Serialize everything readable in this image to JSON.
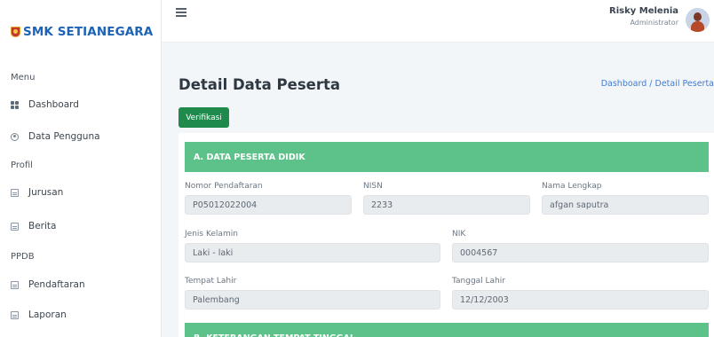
{
  "brand": {
    "name": "SMK SETIANEGARA"
  },
  "sidebar": {
    "menu_heading": "Menu",
    "profil_heading": "Profil",
    "ppdb_heading": "PPDB",
    "items": [
      {
        "label": "Dashboard",
        "icon": "dashboard-grid-icon"
      },
      {
        "label": "Data Pengguna",
        "icon": "user-circle-icon"
      },
      {
        "label": "Jurusan",
        "icon": "document-icon"
      },
      {
        "label": "Berita",
        "icon": "document-icon"
      },
      {
        "label": "Pendaftaran",
        "icon": "document-icon"
      },
      {
        "label": "Laporan",
        "icon": "document-icon"
      }
    ]
  },
  "topbar": {
    "user_name": "Risky Melenia",
    "user_role": "Administrator"
  },
  "page": {
    "title": "Detail Data Peserta",
    "breadcrumb": "Dashboard / Detail Peserta",
    "verify_label": "Verifikasi"
  },
  "section_a": {
    "title": "A. DATA PESERTA DIDIK",
    "fields": {
      "nomor_pendaftaran": {
        "label": "Nomor Pendaftaran",
        "value": "P05012022004"
      },
      "nisn": {
        "label": "NISN",
        "value": "2233"
      },
      "nama_lengkap": {
        "label": "Nama Lengkap",
        "value": "afgan saputra"
      },
      "jenis_kelamin": {
        "label": "Jenis Kelamin",
        "value": "Laki - laki"
      },
      "nik": {
        "label": "NIK",
        "value": "0004567"
      },
      "tempat_lahir": {
        "label": "Tempat Lahir",
        "value": "Palembang"
      },
      "tanggal_lahir": {
        "label": "Tanggal Lahir",
        "value": "12/12/2003"
      }
    }
  },
  "section_b": {
    "title": "B. KETERANGAN TEMPAT TINGGAL"
  },
  "colors": {
    "brand_blue": "#1e63b5",
    "section_green": "#5cc289",
    "button_green": "#1e8a4c",
    "link_blue": "#3d7bd8"
  }
}
